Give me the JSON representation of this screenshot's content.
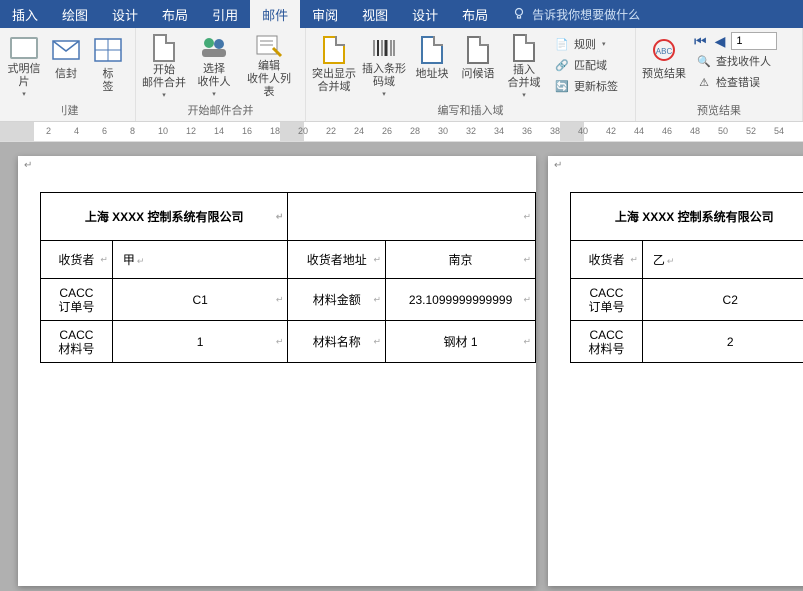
{
  "tabs": {
    "items": [
      {
        "label": "插入"
      },
      {
        "label": "绘图"
      },
      {
        "label": "设计"
      },
      {
        "label": "布局"
      },
      {
        "label": "引用"
      },
      {
        "label": "邮件",
        "active": true
      },
      {
        "label": "审阅"
      },
      {
        "label": "视图"
      },
      {
        "label": "设计"
      },
      {
        "label": "布局"
      }
    ],
    "tell_me_placeholder": "告诉我你想要做什么"
  },
  "ribbon": {
    "group_create": {
      "label": "刂建",
      "postcard": "式明信片",
      "envelope": "信封",
      "labels": "标\n签"
    },
    "group_start": {
      "label": "开始邮件合并",
      "start_merge": "开始\n邮件合并",
      "select_recip": "选择\n收件人",
      "edit_recip": "编辑\n收件人列表"
    },
    "group_write": {
      "label": "编写和插入域",
      "highlight": "突出显示\n合并域",
      "barcode": "插入条形\n码域",
      "address": "地址块",
      "greeting": "问候语",
      "merge_field": "插入\n合并域",
      "rules": "规则",
      "match": "匹配域",
      "update": "更新标签"
    },
    "group_preview": {
      "label": "预览结果",
      "preview": "预览结果",
      "find": "查找收件人",
      "check": "检查错误",
      "record": "1"
    }
  },
  "ruler": {
    "ticks": [
      "2",
      "4",
      "6",
      "8",
      "10",
      "12",
      "14",
      "16",
      "18",
      "20",
      "22",
      "24",
      "26",
      "28",
      "30",
      "32",
      "34",
      "36",
      "38",
      "40",
      "42",
      "44",
      "46",
      "48",
      "50",
      "52",
      "54"
    ]
  },
  "doc": {
    "page1": {
      "title": "上海 XXXX 控制系统有限公司",
      "rows": [
        {
          "l1": "收货者",
          "v1": "甲",
          "l2": "收货者地址",
          "v2": "南京"
        },
        {
          "l1": "CACC\n订单号",
          "v1": "C1",
          "l2": "材料金额",
          "v2": "23.1099999999999"
        },
        {
          "l1": "CACC\n材料号",
          "v1": "1",
          "l2": "材料名称",
          "v2": "钢材 1"
        }
      ]
    },
    "page2": {
      "title": "上海 XXXX 控制系统有限公司",
      "rows": [
        {
          "l1": "收货者",
          "v1": "乙"
        },
        {
          "l1": "CACC\n订单号",
          "v1": "C2"
        },
        {
          "l1": "CACC\n材料号",
          "v1": "2"
        }
      ]
    }
  }
}
